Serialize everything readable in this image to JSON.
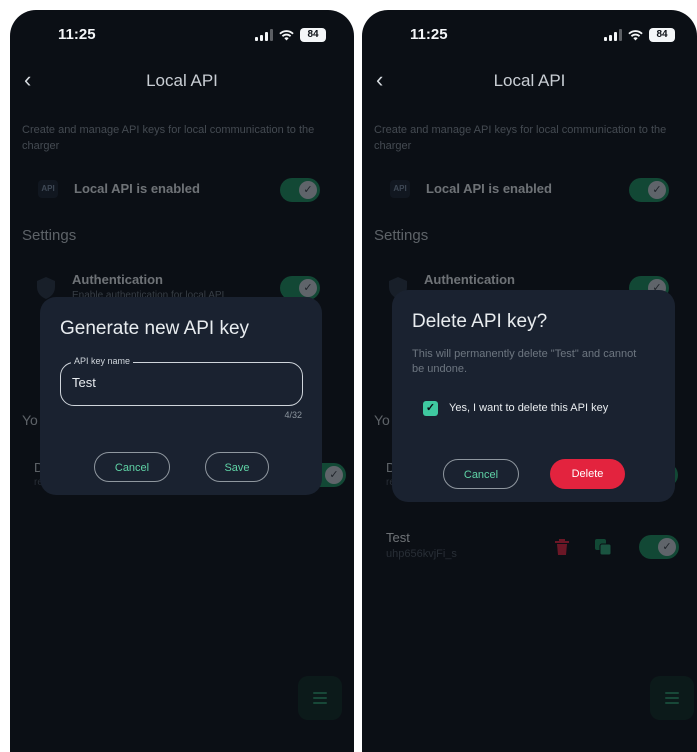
{
  "status": {
    "time": "11:25",
    "battery": "84"
  },
  "header": {
    "back_icon": "chevron-left-icon",
    "title": "Local API"
  },
  "description": "Create and manage API keys for local communication to the charger",
  "api_badge": "API",
  "local_api_label": "Local API is enabled",
  "settings_heading": "Settings",
  "authentication": {
    "label": "Authentication",
    "sublabel": "Enable authentication for local API"
  },
  "partial_texts": {
    "your_keys": "Yo",
    "row_start": "D",
    "row_sub": "re"
  },
  "api_key": {
    "name": "Test",
    "value": "uhp656kvjFi_s"
  },
  "accent_colors": {
    "toggle_on": "#1c8f5e",
    "danger": "#e3233e",
    "link": "#5fd3a6"
  },
  "generate_dialog": {
    "title": "Generate new API key",
    "field_label": "API key name",
    "field_value": "Test",
    "counter": "4/32",
    "cancel_label": "Cancel",
    "save_label": "Save"
  },
  "delete_dialog": {
    "title": "Delete API key?",
    "message": "This will permanently delete \"Test\" and cannot be undone.",
    "checkbox_label": "Yes, I want to delete this API key",
    "checkbox_checked": true,
    "cancel_label": "Cancel",
    "delete_label": "Delete"
  }
}
